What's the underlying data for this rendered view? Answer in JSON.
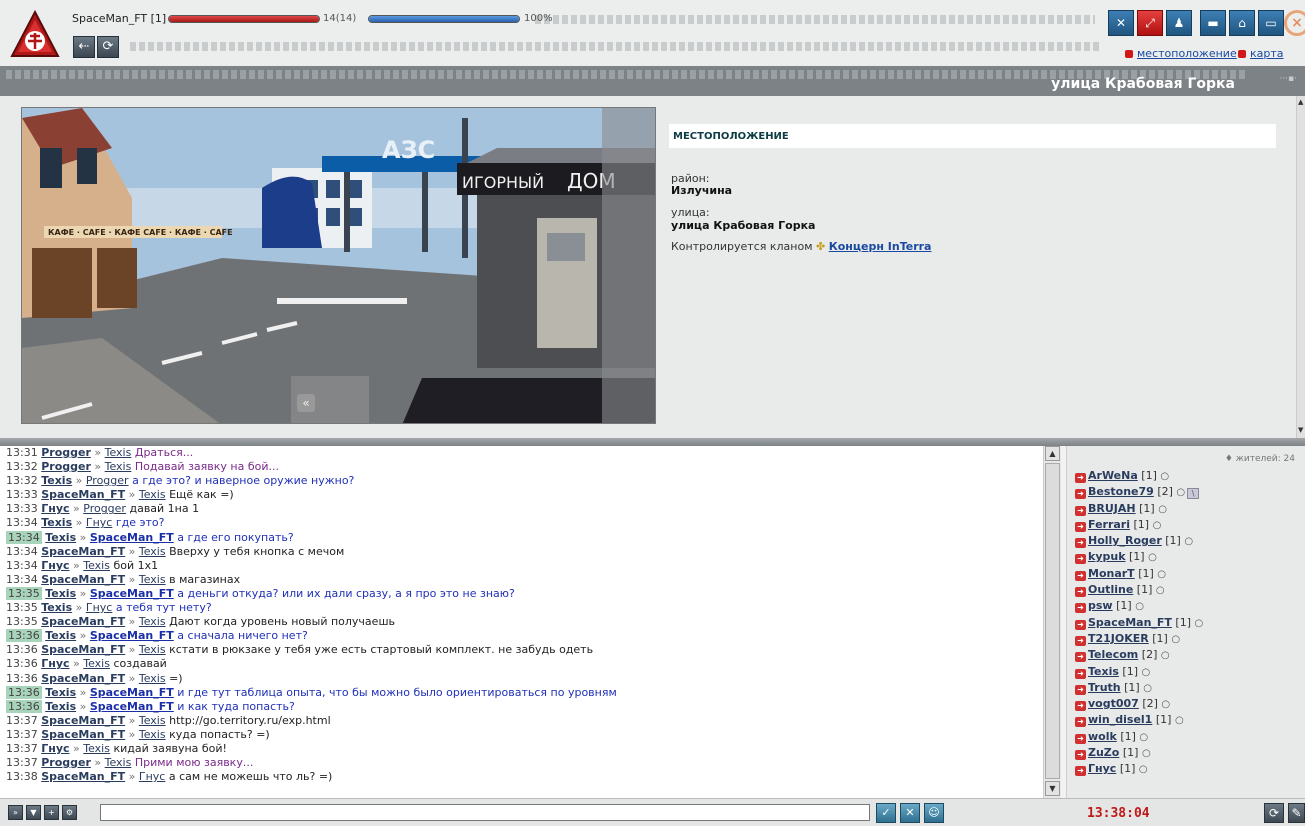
{
  "player": {
    "name": "SpaceMan_FT [1]",
    "hp_text": "14(14)",
    "hp_fraction": 1.0,
    "mp_text": "100%",
    "mp_fraction": 1.0
  },
  "top_links": {
    "location": "местоположение",
    "map": "карта"
  },
  "location": {
    "title": "улица Крабовая Горка",
    "section_header": "МЕСТОПОЛОЖЕНИЕ",
    "district_label": "район:",
    "district": "Излучина",
    "street_label": "улица:",
    "street": "улица Крабовая Горка",
    "control_text": "Контролируется кланом",
    "clan": "Концерн InTerra",
    "scene_signs": {
      "gas": "АЗС",
      "casino_left": "ИГОРНЫЙ",
      "casino_right": "ДОМ",
      "cafe": "КАФЕ · CAFE · КАФЕ  CAFE · КАФЕ · CAFE"
    }
  },
  "chat": {
    "lines": [
      {
        "time": "13:31",
        "from": "Progger",
        "to": "Texis",
        "text": "Драться...",
        "style": "purple",
        "hl": false
      },
      {
        "time": "13:32",
        "from": "Progger",
        "to": "Texis",
        "text": "Подавай заявку на бой...",
        "style": "purple",
        "hl": false
      },
      {
        "time": "13:32",
        "from": "Texis",
        "to": "Progger",
        "text": "а где это? и наверное оружие нужно?",
        "style": "blue",
        "hl": false
      },
      {
        "time": "13:33",
        "from": "SpaceMan_FT",
        "to": "Texis",
        "text": "Ещё как =)",
        "style": "normal",
        "hl": false
      },
      {
        "time": "13:33",
        "from": "Гнус",
        "to": "Progger",
        "text": "давай 1на 1",
        "style": "normal",
        "hl": false
      },
      {
        "time": "13:34",
        "from": "Texis",
        "to": "Гнус",
        "text": "где это?",
        "style": "blue",
        "hl": false
      },
      {
        "time": "13:34",
        "from": "Texis",
        "to": "SpaceMan_FT",
        "text": "а где его покупать?",
        "style": "blue",
        "hl": true
      },
      {
        "time": "13:34",
        "from": "SpaceMan_FT",
        "to": "Texis",
        "text": "Вверху у тебя кнопка с мечом",
        "style": "normal",
        "hl": false
      },
      {
        "time": "13:34",
        "from": "Гнус",
        "to": "Texis",
        "text": "бой 1x1",
        "style": "normal",
        "hl": false
      },
      {
        "time": "13:34",
        "from": "SpaceMan_FT",
        "to": "Texis",
        "text": "в магазинах",
        "style": "normal",
        "hl": false
      },
      {
        "time": "13:35",
        "from": "Texis",
        "to": "SpaceMan_FT",
        "text": "а деньги откуда? или их дали сразу, а я про это не знаю?",
        "style": "blue",
        "hl": true
      },
      {
        "time": "13:35",
        "from": "Texis",
        "to": "Гнус",
        "text": "а тебя тут нету?",
        "style": "blue",
        "hl": false
      },
      {
        "time": "13:35",
        "from": "SpaceMan_FT",
        "to": "Texis",
        "text": "Дают когда уровень новый получаешь",
        "style": "normal",
        "hl": false
      },
      {
        "time": "13:36",
        "from": "Texis",
        "to": "SpaceMan_FT",
        "text": "а сначала ничего нет?",
        "style": "blue",
        "hl": true
      },
      {
        "time": "13:36",
        "from": "SpaceMan_FT",
        "to": "Texis",
        "text": "кстати в рюкзаке у тебя уже есть стартовый комплект. не забудь одеть",
        "style": "normal",
        "hl": false
      },
      {
        "time": "13:36",
        "from": "Гнус",
        "to": "Texis",
        "text": "создавай",
        "style": "normal",
        "hl": false
      },
      {
        "time": "13:36",
        "from": "SpaceMan_FT",
        "to": "Texis",
        "text": "=)",
        "style": "normal",
        "hl": false
      },
      {
        "time": "13:36",
        "from": "Texis",
        "to": "SpaceMan_FT",
        "text": "и где тут таблица опыта, что бы можно было ориентироваться по уровням",
        "style": "blue",
        "hl": true
      },
      {
        "time": "13:36",
        "from": "Texis",
        "to": "SpaceMan_FT",
        "text": "и как туда попасть?",
        "style": "blue",
        "hl": true
      },
      {
        "time": "13:37",
        "from": "SpaceMan_FT",
        "to": "Texis",
        "text": "http://go.territory.ru/exp.html",
        "style": "normal",
        "hl": false
      },
      {
        "time": "13:37",
        "from": "SpaceMan_FT",
        "to": "Texis",
        "text": "куда попасть? =)",
        "style": "normal",
        "hl": false
      },
      {
        "time": "13:37",
        "from": "Гнус",
        "to": "Texis",
        "text": "кидай заявуна бой!",
        "style": "normal",
        "hl": false
      },
      {
        "time": "13:37",
        "from": "Progger",
        "to": "Texis",
        "text": "Прими мою заявку...",
        "style": "purple",
        "hl": false
      },
      {
        "time": "13:38",
        "from": "SpaceMan_FT",
        "to": "Гнус",
        "text": "а сам не можешь что ль? =)",
        "style": "normal",
        "hl": false
      }
    ]
  },
  "users": {
    "count_label": "♦ жителей: 24",
    "list": [
      {
        "name": "ArWeNa",
        "level": "[1]",
        "extra": false
      },
      {
        "name": "Bestone79",
        "level": "[2]",
        "extra": true
      },
      {
        "name": "BRUJAH",
        "level": "[1]",
        "extra": false
      },
      {
        "name": "Ferrari",
        "level": "[1]",
        "extra": false
      },
      {
        "name": "Holly_Roger",
        "level": "[1]",
        "extra": false
      },
      {
        "name": "kypuk",
        "level": "[1]",
        "extra": false
      },
      {
        "name": "MonarT",
        "level": "[1]",
        "extra": false
      },
      {
        "name": "Outline",
        "level": "[1]",
        "extra": false
      },
      {
        "name": "psw",
        "level": "[1]",
        "extra": false
      },
      {
        "name": "SpaceMan_FT",
        "level": "[1]",
        "extra": false
      },
      {
        "name": "T21JOKER",
        "level": "[1]",
        "extra": false
      },
      {
        "name": "Telecom",
        "level": "[2]",
        "extra": false
      },
      {
        "name": "Texis",
        "level": "[1]",
        "extra": false
      },
      {
        "name": "Truth",
        "level": "[1]",
        "extra": false
      },
      {
        "name": "vogt007",
        "level": "[2]",
        "extra": false
      },
      {
        "name": "win_disel1",
        "level": "[1]",
        "extra": false
      },
      {
        "name": "wolk",
        "level": "[1]",
        "extra": false
      },
      {
        "name": "ZuZo",
        "level": "[1]",
        "extra": false
      },
      {
        "name": "Гнус",
        "level": "[1]",
        "extra": false
      }
    ]
  },
  "bottom": {
    "clock": "13:38:04",
    "input_value": ""
  },
  "colors": {
    "accent_red": "#c01818",
    "link": "#1a4aa0",
    "highlight": "#a9d4bc"
  }
}
